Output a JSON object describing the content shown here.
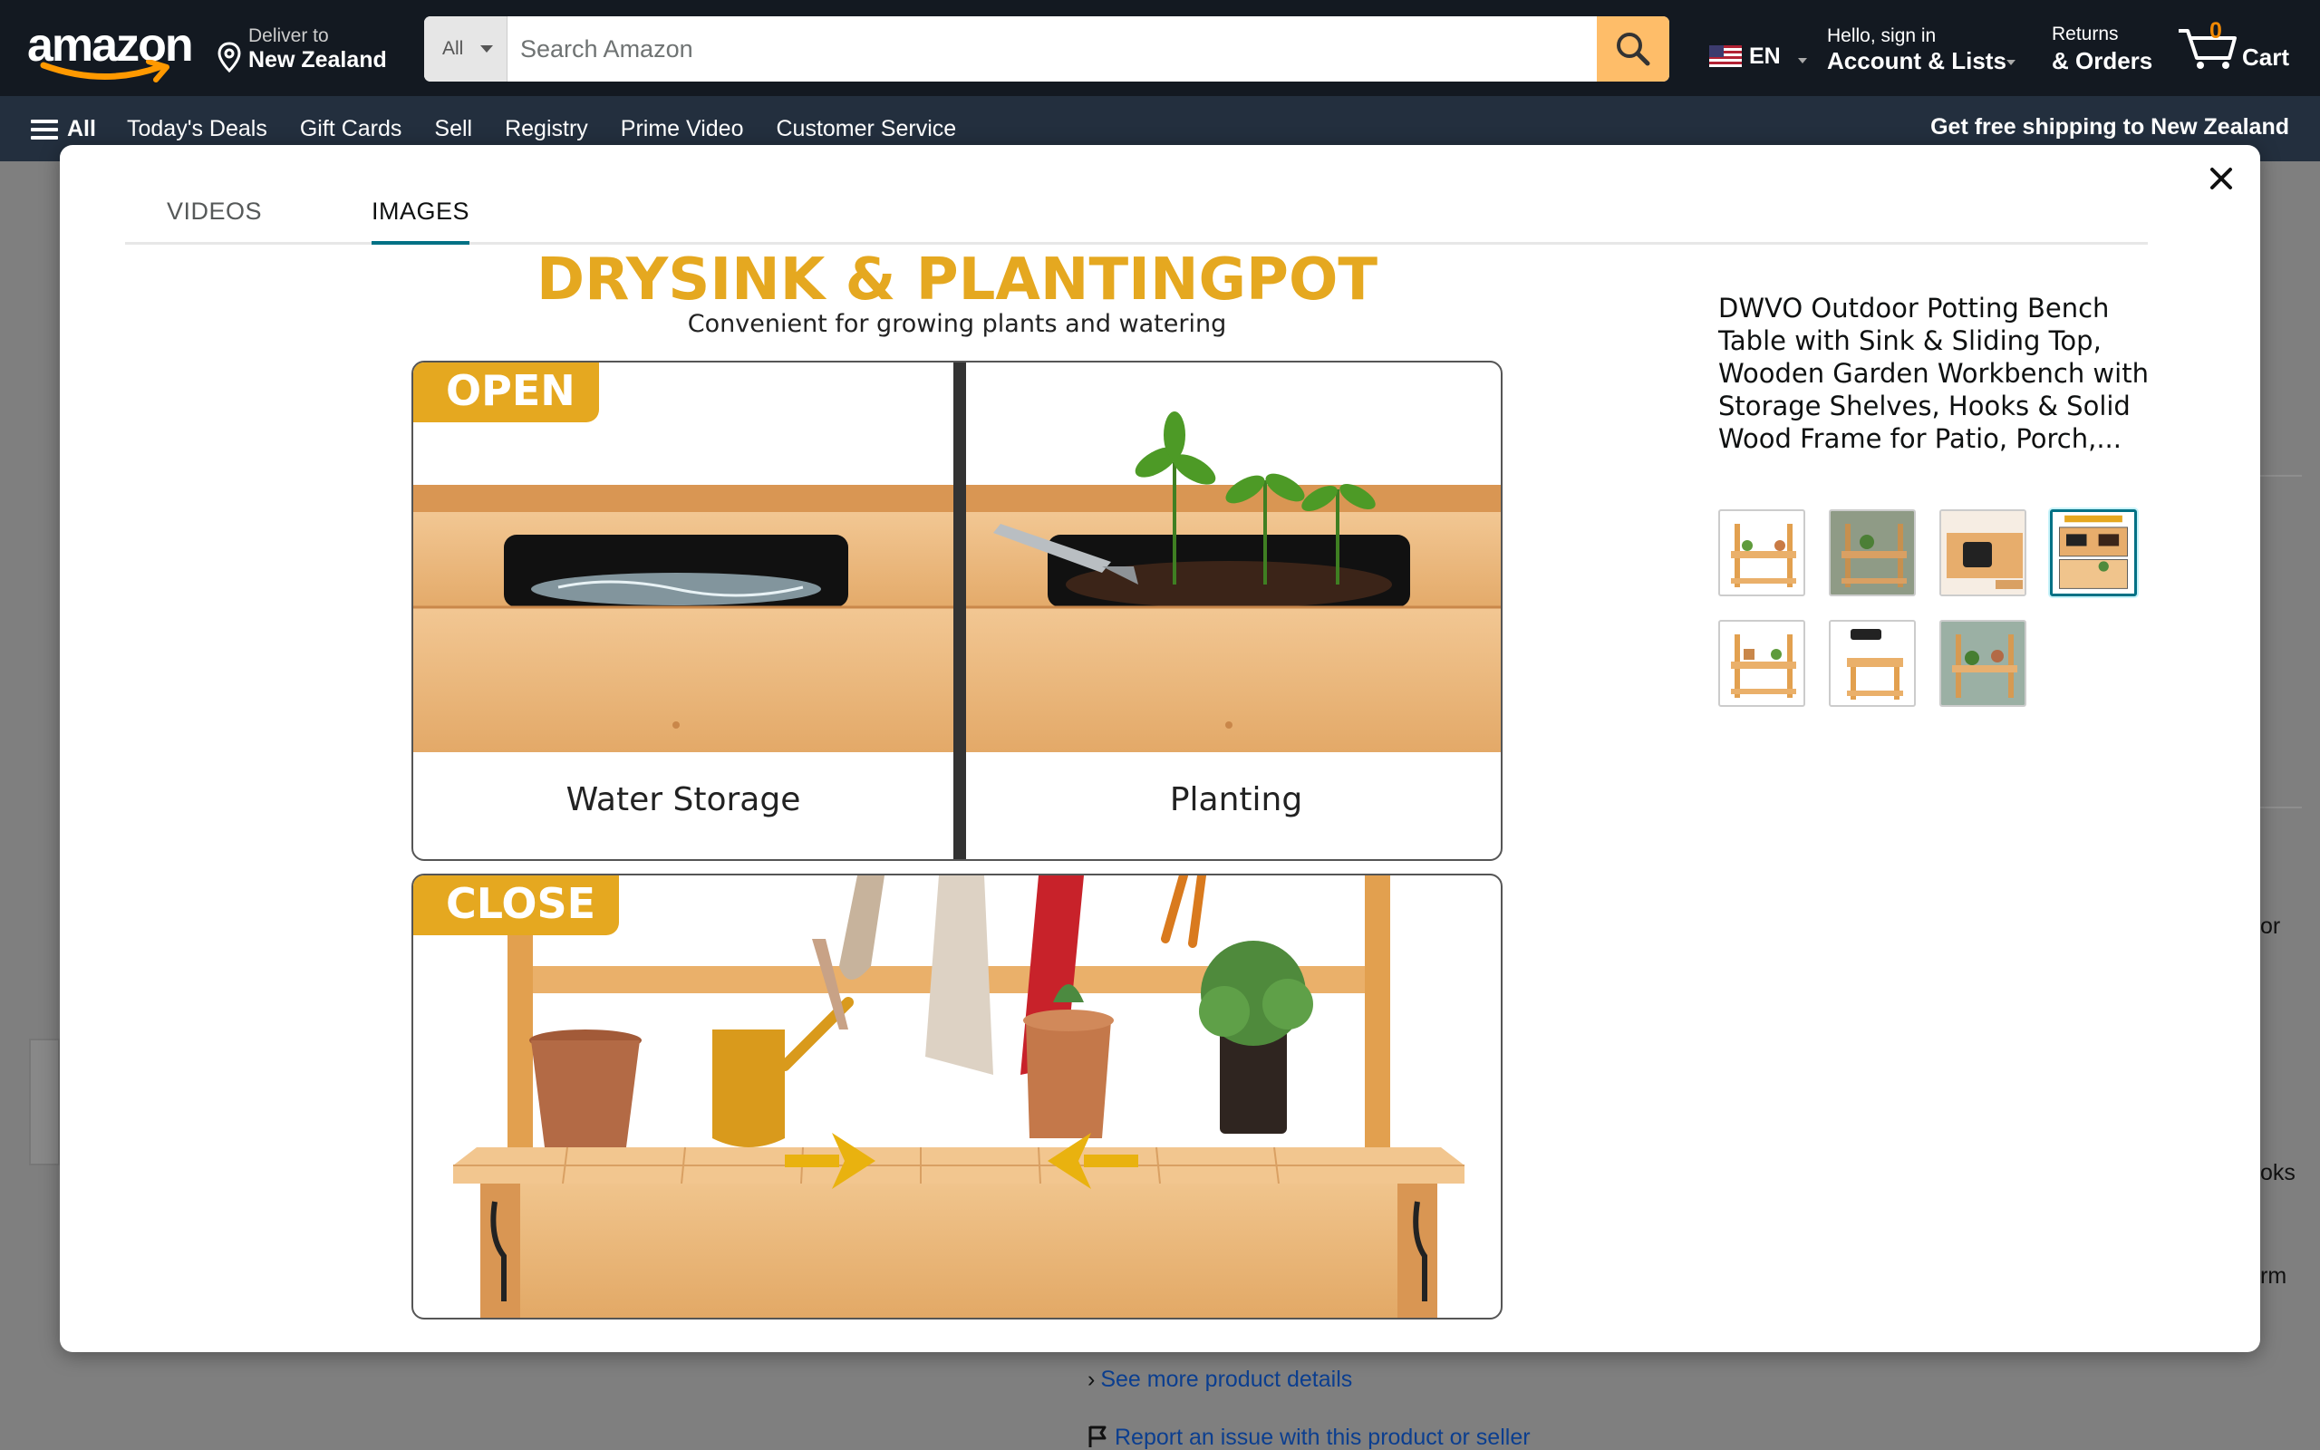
{
  "header": {
    "logo_text": "amazon",
    "deliver_line1": "Deliver to",
    "deliver_line2": "New Zealand",
    "search_category": "All",
    "search_placeholder": "Search Amazon",
    "language": "EN",
    "account_line1": "Hello, sign in",
    "account_line2": "Account & Lists",
    "returns_line1": "Returns",
    "returns_line2": "& Orders",
    "cart_count": "0",
    "cart_label": "Cart"
  },
  "subnav": {
    "all_label": "All",
    "links": [
      "Today's Deals",
      "Gift Cards",
      "Sell",
      "Registry",
      "Prime Video",
      "Customer Service"
    ],
    "promo": "Get free shipping to New Zealand"
  },
  "background": {
    "fragments": [
      "or",
      "oks",
      "rm"
    ],
    "see_more": "See more product details",
    "report": "Report an issue with this product or seller"
  },
  "modal": {
    "tabs": [
      {
        "label": "VIDEOS",
        "active": false
      },
      {
        "label": "IMAGES",
        "active": true
      }
    ],
    "image": {
      "headline": "DRYSINK & PLANTINGPOT",
      "subline": "Convenient for growing plants and watering",
      "open_badge": "OPEN",
      "close_badge": "CLOSE",
      "left_caption": "Water Storage",
      "right_caption": "Planting"
    },
    "product_title": "DWVO Outdoor Potting Bench Table with Sink & Sliding Top, Wooden Garden Workbench with Storage Shelves, Hooks & Solid Wood Frame for Patio, Porch,...",
    "thumbnail_count": 7,
    "selected_thumbnail": 4
  },
  "colors": {
    "nav_dark": "#131921",
    "nav_secondary": "#232f3e",
    "search_button": "#febd69",
    "accent_teal": "#007185",
    "badge_gold": "#e5a820",
    "wood": "#e8b577"
  }
}
